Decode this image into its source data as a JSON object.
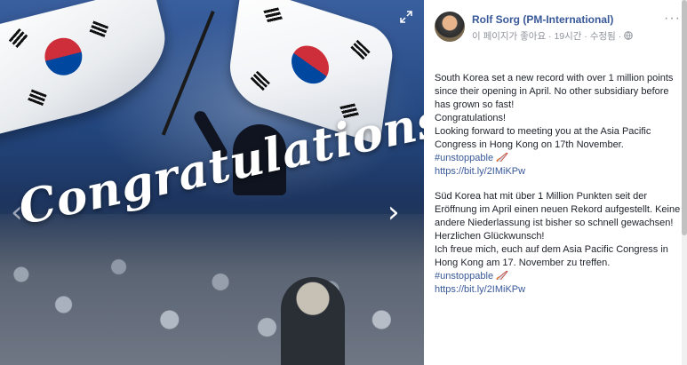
{
  "photo": {
    "caption_art": "Congratulations",
    "nav_prev_glyph": "‹",
    "nav_next_glyph": "›",
    "flag_colors": {
      "red": "#cd2e3a",
      "blue": "#0047a0",
      "black": "#111111",
      "white": "#ffffff"
    }
  },
  "post": {
    "author": "Rolf Sorg (PM-International)",
    "like_page": "이 페이지가 좋아요",
    "separator": " · ",
    "time": "19시간",
    "edited": "수정됨",
    "more_glyph": "···",
    "paragraph_en": {
      "line1": "South Korea set a new record with over 1 million points since their opening in April. No other subsidiary before has grown so fast!",
      "line2": "Congratulations!",
      "line3": "Looking forward to meeting you at the Asia Pacific Congress in Hong Kong on 17th November.",
      "hashtag": "#unstoppable",
      "link": "https://bit.ly/2IMiKPw"
    },
    "paragraph_de": {
      "line1": "Süd Korea hat mit über 1 Million Punkten seit der Eröffnung im April einen neuen Rekord aufgestellt. Keine andere Niederlassung ist bisher so schnell gewachsen! Herzlichen Glückwunsch!",
      "line2": "Ich freue mich, euch auf dem Asia Pacific Congress in Hong Kong am 17. November zu treffen.",
      "hashtag": "#unstoppable",
      "link": "https://bit.ly/2IMiKPw"
    },
    "link_color": "#385898"
  }
}
